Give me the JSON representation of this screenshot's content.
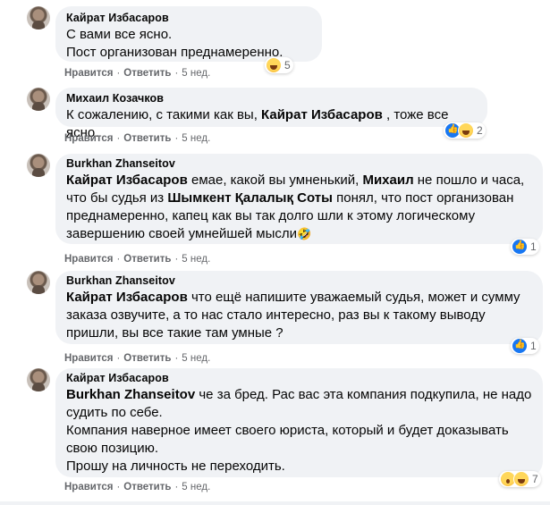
{
  "comments": [
    {
      "author": "Кайрат Избасаров",
      "text": "С вами все ясно.\nПост организован преднамеренно.",
      "like_label": "Нравится",
      "reply_label": "Ответить",
      "time": "5 нед.",
      "reactions": {
        "icons": [
          "haha-emoji"
        ],
        "count": "5"
      }
    },
    {
      "author": "Михаил Козачков",
      "text_before": "К сожалению, с такими как вы, ",
      "mention": "Кайрат Избасаров",
      "text_after": " , тоже все ясно.",
      "like_label": "Нравится",
      "reply_label": "Ответить",
      "time": "5 нед.",
      "reactions": {
        "icons": [
          "like-emoji",
          "haha-emoji"
        ],
        "count": "2"
      }
    },
    {
      "author": "Burkhan Zhanseitov",
      "mention1": "Кайрат Избасаров",
      "t1": " емае, какой вы умненький, ",
      "mention2": "Михаил",
      "t2": " не пошло и часа, что бы судья из ",
      "mention3": "Шымкент Қалалық Соты",
      "t3": " понял, что пост организован преднамеренно, капец как вы так долго шли к этому логическому завершению своей умнейшей мысли",
      "emoji": "🤣",
      "like_label": "Нравится",
      "reply_label": "Ответить",
      "time": "5 нед.",
      "reactions": {
        "icons": [
          "like-emoji"
        ],
        "count": "1"
      }
    },
    {
      "author": "Burkhan Zhanseitov",
      "mention": "Кайрат Избасаров",
      "text": " что ещё напишите уважаемый судья, может и сумму заказа озвучите, а то нас стало интересно, раз вы к такому выводу пришли, вы все такие там умные ?",
      "like_label": "Нравится",
      "reply_label": "Ответить",
      "time": "5 нед.",
      "reactions": {
        "icons": [
          "like-emoji"
        ],
        "count": "1"
      }
    },
    {
      "author": "Кайрат Избасаров",
      "mention": "Burkhan Zhanseitov",
      "text": " че за бред. Рас вас эта компания подкупила, не надо судить по себе.\nКомпания наверное имеет своего юриста, который и будет доказывать свою позицию.\nПрошу на личность не переходить.",
      "like_label": "Нравится",
      "reply_label": "Ответить",
      "time": "5 нед.",
      "reactions": {
        "icons": [
          "wow-emoji",
          "haha-emoji"
        ],
        "count": "7"
      }
    }
  ]
}
